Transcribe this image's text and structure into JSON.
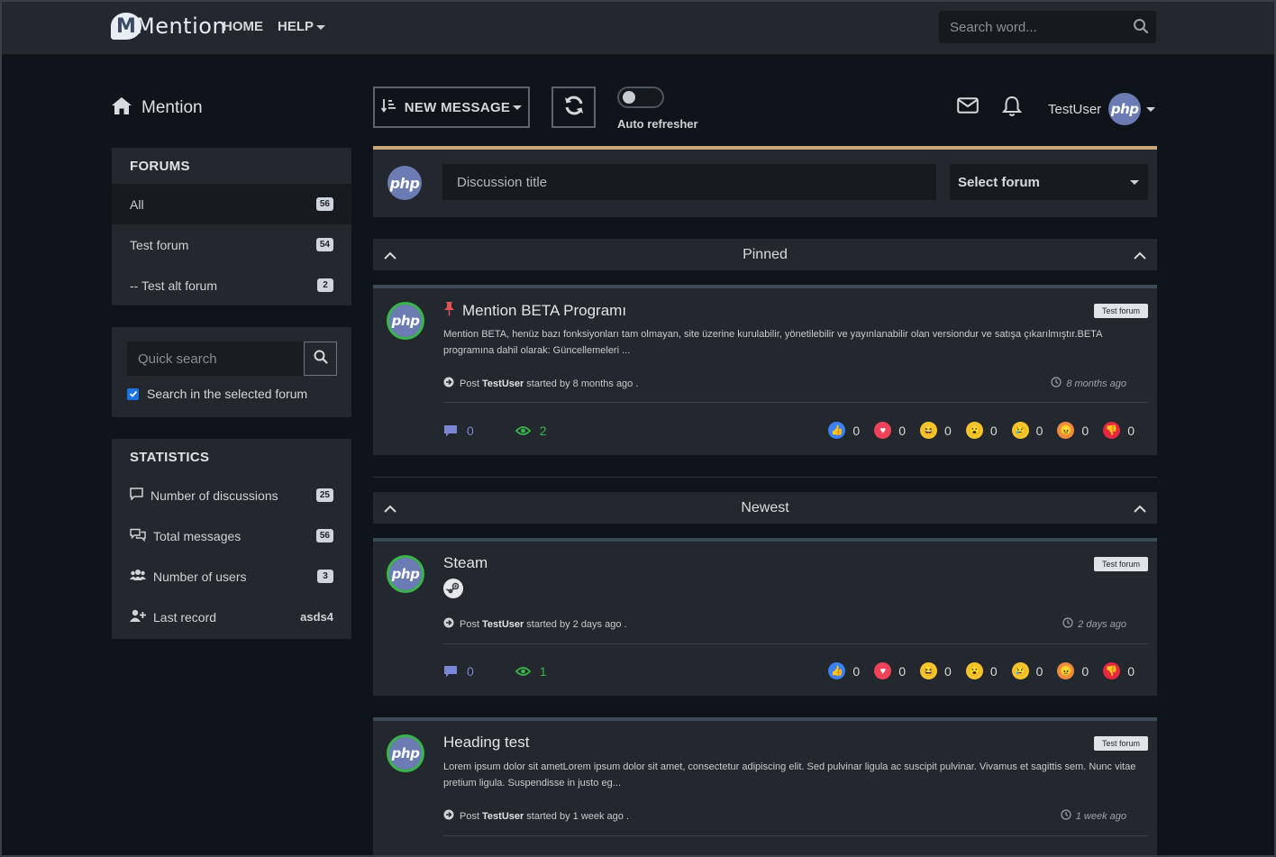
{
  "nav": {
    "logo_text": "Mention",
    "logo_letter": "M",
    "home": "HOME",
    "help": "HELP",
    "search_placeholder": "Search word..."
  },
  "sidebar": {
    "title": "Mention",
    "forums_header": "FORUMS",
    "forums": [
      {
        "label": "All",
        "count": "56"
      },
      {
        "label": "Test forum",
        "count": "54"
      },
      {
        "label": "-- Test alt forum",
        "count": "2"
      }
    ],
    "quick_search_placeholder": "Quick search",
    "search_selected_label": "Search in the selected forum",
    "statistics_header": "STATISTICS",
    "stats": [
      {
        "label": "Number of discussions",
        "value": "25",
        "icon": "comment-icon"
      },
      {
        "label": "Total messages",
        "value": "56",
        "icon": "comments-icon"
      },
      {
        "label": "Number of users",
        "value": "3",
        "icon": "users-icon"
      },
      {
        "label": "Last record",
        "value": "asds4",
        "icon": "user-plus-icon"
      }
    ]
  },
  "toolbar": {
    "new_message": "NEW MESSAGE",
    "auto_refresher": "Auto refresher",
    "username": "TestUser",
    "avatar_text": "php"
  },
  "compose": {
    "title_placeholder": "Discussion title",
    "select_forum": "Select forum"
  },
  "sections": {
    "pinned": "Pinned",
    "newest": "Newest"
  },
  "posts": [
    {
      "title": "Mention BETA Programı",
      "forum": "Test forum",
      "body": "Mention BETA, henüz bazı fonksiyonları tam olmayan, site üzerine kurulabilir, yönetilebilir ve yayınlanabilir olan versiondur ve satışa çıkarılmıştır.BETA programına dahil olarak: Güncellemeleri ...",
      "meta_prefix": "Post",
      "author": "TestUser",
      "meta_suffix": "started by 8 months ago .",
      "ago": "8 months ago",
      "comments": "0",
      "views": "2",
      "reactions": [
        "0",
        "0",
        "0",
        "0",
        "0",
        "0",
        "0"
      ]
    },
    {
      "title": "Steam",
      "forum": "Test forum",
      "meta_prefix": "Post",
      "author": "TestUser",
      "meta_suffix": "started by 2 days ago .",
      "ago": "2 days ago",
      "comments": "0",
      "views": "1",
      "reactions": [
        "0",
        "0",
        "0",
        "0",
        "0",
        "0",
        "0"
      ]
    },
    {
      "title": "Heading test",
      "forum": "Test forum",
      "body": "Lorem ipsum dolor sit ametLorem ipsum dolor sit amet, consectetur adipiscing elit. Sed pulvinar ligula ac suscipit pulvinar. Vivamus et sagittis sem. Nunc vitae pretium ligula. Suspendisse in justo eg...",
      "meta_prefix": "Post",
      "author": "TestUser",
      "meta_suffix": "started by 1 week ago .",
      "ago": "1 week ago"
    }
  ],
  "colors": {
    "accent_bar": "#c9a57a",
    "views_green": "#3ab54a",
    "comments_purple": "#7b86d6"
  }
}
